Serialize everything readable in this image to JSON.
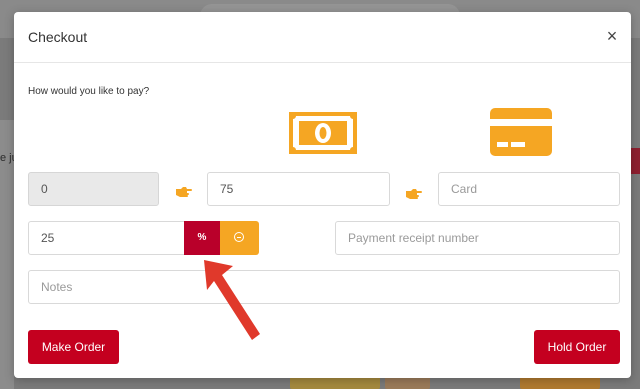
{
  "background": {
    "partial_text": "e ju"
  },
  "modal": {
    "title": "Checkout",
    "close_symbol": "×"
  },
  "payment": {
    "question": "How would you like to pay?",
    "methods": [
      {
        "name": "cash",
        "icon": "cash-icon",
        "color": "#f5a623"
      },
      {
        "name": "card",
        "icon": "credit-card-icon",
        "color": "#f5a623"
      }
    ],
    "pointer_icon": "hand-pointing-right-icon",
    "remaining_value": "0",
    "cash_value": "75",
    "card_placeholder": "Card",
    "discount_value": "25",
    "discount_type_label": "%",
    "receipt_placeholder": "Payment receipt number",
    "notes_placeholder": "Notes"
  },
  "actions": {
    "make_order_label": "Make Order",
    "hold_order_label": "Hold Order"
  },
  "colors": {
    "accent_red": "#c4001f",
    "accent_orange": "#f5a623",
    "annotation_arrow": "#e0392b"
  }
}
